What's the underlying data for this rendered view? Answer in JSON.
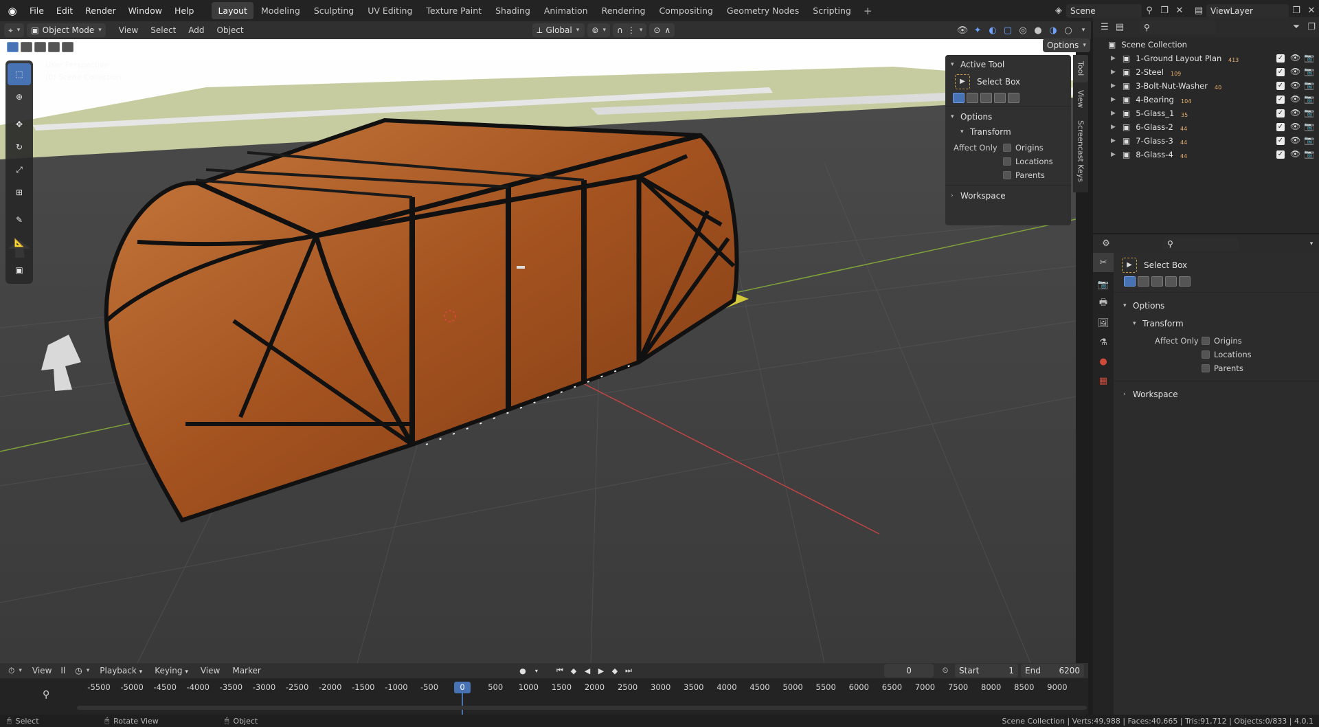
{
  "topbar": {
    "menus": [
      "File",
      "Edit",
      "Render",
      "Window",
      "Help"
    ],
    "workspaces": [
      "Layout",
      "Modeling",
      "Sculpting",
      "UV Editing",
      "Texture Paint",
      "Shading",
      "Animation",
      "Rendering",
      "Compositing",
      "Geometry Nodes",
      "Scripting"
    ],
    "active_workspace": "Layout",
    "scene_name": "Scene",
    "view_layer": "ViewLayer"
  },
  "viewport_header": {
    "mode": "Object Mode",
    "menus": [
      "View",
      "Select",
      "Add",
      "Object"
    ],
    "orientation": "Global",
    "options_label": "Options"
  },
  "viewport": {
    "hud_line1": "User Perspective",
    "hud_line2": "(0) Scene Collection"
  },
  "npanel": {
    "active_tool_title": "Active Tool",
    "tool_name": "Select Box",
    "options_title": "Options",
    "transform_title": "Transform",
    "affect_only_label": "Affect Only",
    "checkboxes": [
      "Origins",
      "Locations",
      "Parents"
    ],
    "workspace_title": "Workspace",
    "tabs": [
      "Tool",
      "View",
      "Screencast Keys"
    ]
  },
  "outliner": {
    "root": "Scene Collection",
    "items": [
      {
        "name": "1-Ground Layout Plan",
        "count": "413"
      },
      {
        "name": "2-Steel",
        "count": "109"
      },
      {
        "name": "3-Bolt-Nut-Washer",
        "count": "40"
      },
      {
        "name": "4-Bearing",
        "count": "104"
      },
      {
        "name": "5-Glass_1",
        "count": "35"
      },
      {
        "name": "6-Glass-2",
        "count": "44"
      },
      {
        "name": "7-Glass-3",
        "count": "44"
      },
      {
        "name": "8-Glass-4",
        "count": "44"
      }
    ]
  },
  "properties": {
    "tool_name": "Select Box",
    "options_title": "Options",
    "transform_title": "Transform",
    "affect_only_label": "Affect Only",
    "checkboxes": [
      "Origins",
      "Locations",
      "Parents"
    ],
    "workspace_title": "Workspace"
  },
  "timeline": {
    "menus": [
      "View",
      "Playback",
      "Keying",
      "View",
      "Marker"
    ],
    "cut_label": "Il",
    "current_frame": "0",
    "start_label": "Start",
    "start_value": "1",
    "end_label": "End",
    "end_value": "6200",
    "ticks": [
      "-5500",
      "-5000",
      "-4500",
      "-4000",
      "-3500",
      "-3000",
      "-2500",
      "-2000",
      "-1500",
      "-1000",
      "-500",
      "0",
      "500",
      "1000",
      "1500",
      "2000",
      "2500",
      "3000",
      "3500",
      "4000",
      "4500",
      "5000",
      "5500",
      "6000",
      "6500",
      "7000",
      "7500",
      "8000",
      "8500",
      "9000"
    ]
  },
  "statusbar": {
    "select": "Select",
    "rotate": "Rotate View",
    "object": "Object",
    "stats": "Scene Collection | Verts:49,988 | Faces:40,665 | Tris:91,712 | Objects:0/833 | 4.0.1"
  }
}
